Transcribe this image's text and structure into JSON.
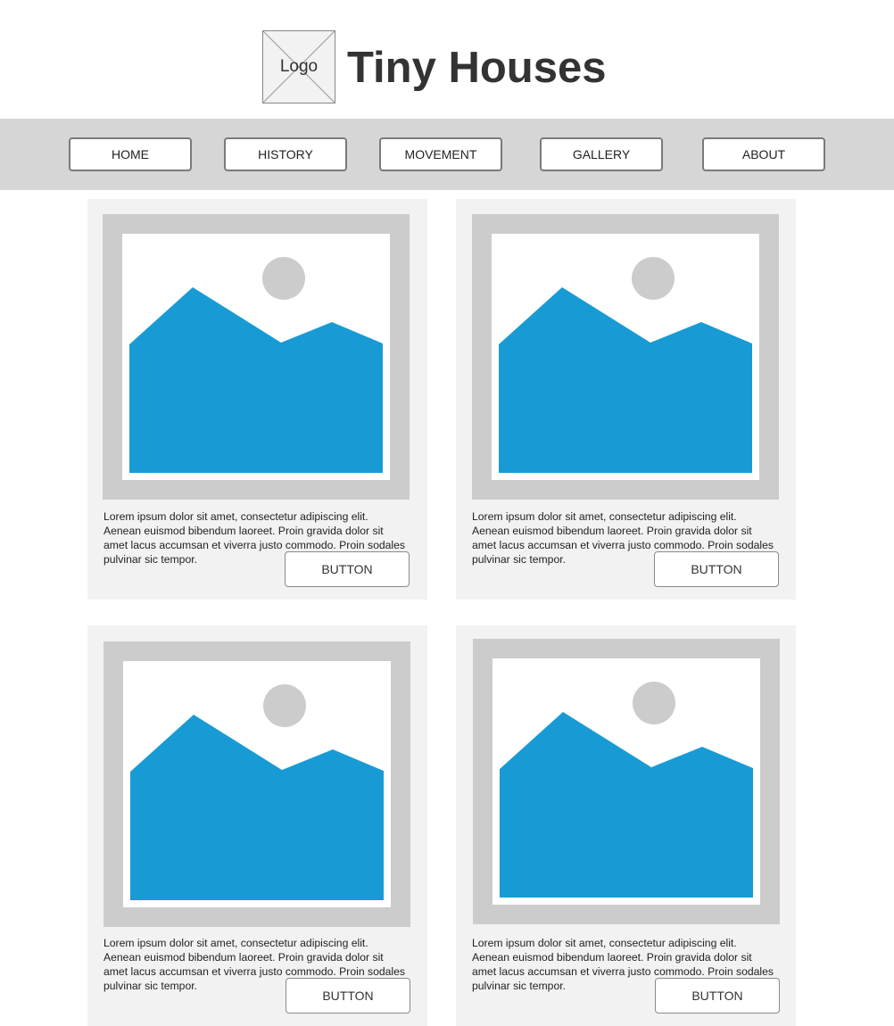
{
  "header": {
    "logo_label": "Logo",
    "title": "Tiny Houses"
  },
  "nav": {
    "items": [
      {
        "label": "HOME"
      },
      {
        "label": "HISTORY"
      },
      {
        "label": "MOVEMENT"
      },
      {
        "label": "GALLERY"
      },
      {
        "label": "ABOUT"
      }
    ]
  },
  "cards": [
    {
      "text": "Lorem ipsum dolor sit amet, consectetur adipiscing elit. Aenean euismod bibendum laoreet. Proin gravida dolor sit amet lacus accumsan et viverra justo commodo. Proin sodales pulvinar sic tempor.",
      "button_label": "BUTTON"
    },
    {
      "text": "Lorem ipsum dolor sit amet, consectetur adipiscing elit. Aenean euismod bibendum laoreet. Proin gravida dolor sit amet lacus accumsan et viverra justo commodo. Proin sodales pulvinar sic tempor.",
      "button_label": "BUTTON"
    },
    {
      "text": "Lorem ipsum dolor sit amet, consectetur adipiscing elit. Aenean euismod bibendum laoreet. Proin gravida dolor sit amet lacus accumsan et viverra justo commodo. Proin sodales pulvinar sic tempor.",
      "button_label": "BUTTON"
    },
    {
      "text": "Lorem ipsum dolor sit amet, consectetur adipiscing elit. Aenean euismod bibendum laoreet. Proin gravida dolor sit amet lacus accumsan et viverra justo commodo. Proin sodales pulvinar sic tempor.",
      "button_label": "BUTTON"
    }
  ],
  "colors": {
    "nav_background": "#d6d6d6",
    "card_background": "#f2f2f2",
    "image_frame": "#cccccc",
    "image_mountain": "#189bd5",
    "image_sun": "#cccccc",
    "title_text": "#333333"
  },
  "icons": {
    "logo": "logo-placeholder-icon",
    "card_image": "image-placeholder-icon"
  }
}
